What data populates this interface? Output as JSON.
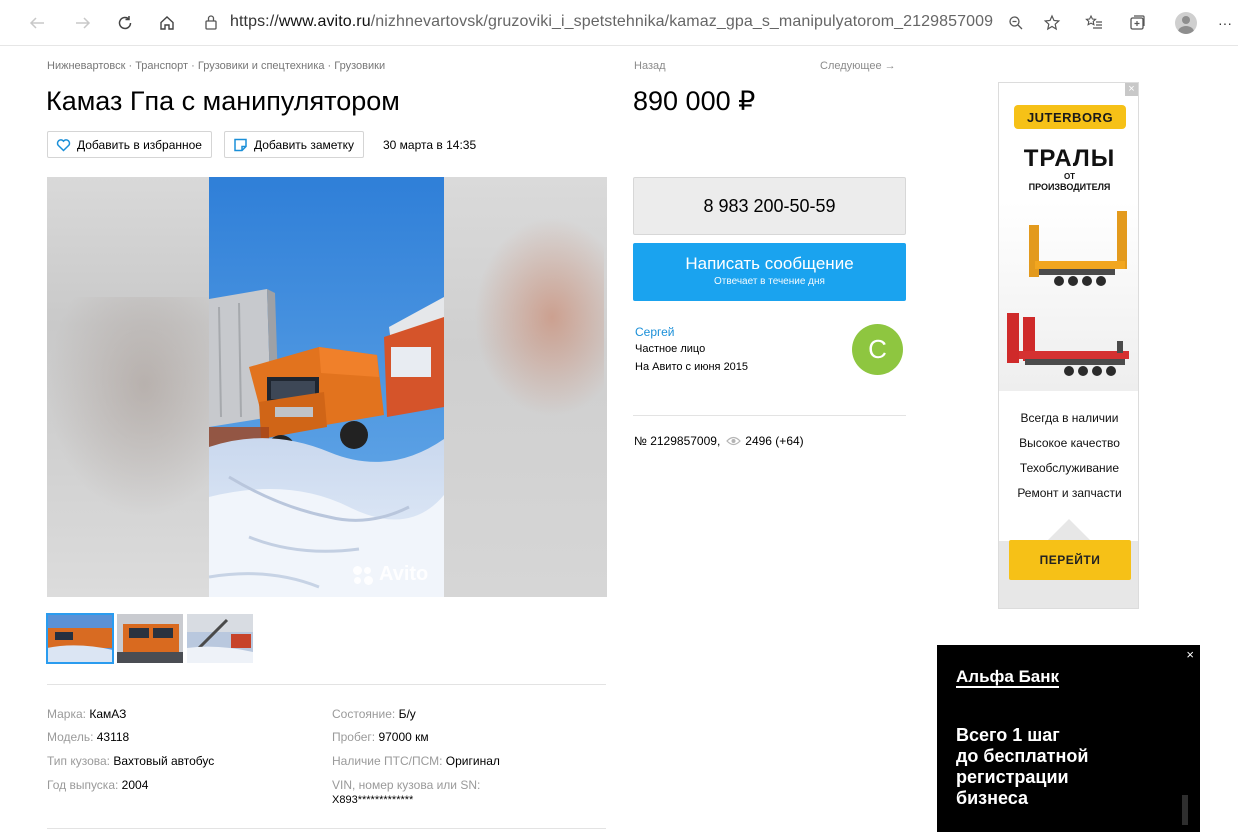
{
  "browser": {
    "url_prefix": "https://",
    "url_host": "www.avito.ru",
    "url_path": "/nizhnevartovsk/gruzoviki_i_spetstehnika/kamaz_gpa_s_manipulyatorom_2129857009",
    "more_label": "···"
  },
  "breadcrumb": "Нижневартовск · Транспорт · Грузовики и спецтехника · Грузовики",
  "listing": {
    "title": "Камаз Гпа с манипулятором",
    "favorite_label": "Добавить в избранное",
    "note_label": "Добавить заметку",
    "date": "30 марта в 14:35",
    "watermark": "Avito"
  },
  "nav": {
    "back": "Назад",
    "next": "Следующее →"
  },
  "price": "890 000 ₽",
  "contact": {
    "phone": "8 983 200-50-59",
    "message_label": "Написать сообщение",
    "message_sub": "Отвечает в течение дня"
  },
  "seller": {
    "name": "Сергей",
    "type": "Частное лицо",
    "since": "На Авито с июня 2015",
    "avatar_letter": "С",
    "avatar_color": "#8ec640"
  },
  "ad_info": {
    "number": "№ 2129857009,",
    "views": "2496 (+64)"
  },
  "params": [
    {
      "key": "Марка:",
      "value": "КамАЗ"
    },
    {
      "key": "Модель:",
      "value": "43118"
    },
    {
      "key": "Тип кузова:",
      "value": "Вахтовый автобус"
    },
    {
      "key": "Год выпуска:",
      "value": "2004"
    },
    {
      "key": "Состояние:",
      "value": "Б/у"
    },
    {
      "key": "Пробег:",
      "value": "97000 км"
    },
    {
      "key": "Наличие ПТС/ПСМ:",
      "value": "Оригинал"
    },
    {
      "key": "VIN, номер кузова или SN:",
      "value": "X893*************"
    }
  ],
  "banner1": {
    "brand": "JUTERBORG",
    "headline": "ТРАЛЫ",
    "sub1": "ОТ",
    "sub2": "ПРОИЗВОДИТЕЛЯ",
    "features": [
      "Всегда в наличии",
      "Высокое качество",
      "Техобслуживание",
      "Ремонт и запчасти"
    ],
    "cta": "ПЕРЕЙТИ",
    "close": "×",
    "accent": "#f6c117"
  },
  "banner2": {
    "brand": "Альфа Банк",
    "lines": [
      "Всего 1 шаг",
      "до бесплатной",
      "регистрации",
      "бизнеса"
    ],
    "close": "×"
  },
  "colors": {
    "link": "#1a8fd8",
    "message_button": "#1aa3ef",
    "thumb_active": "#2a9cef"
  }
}
